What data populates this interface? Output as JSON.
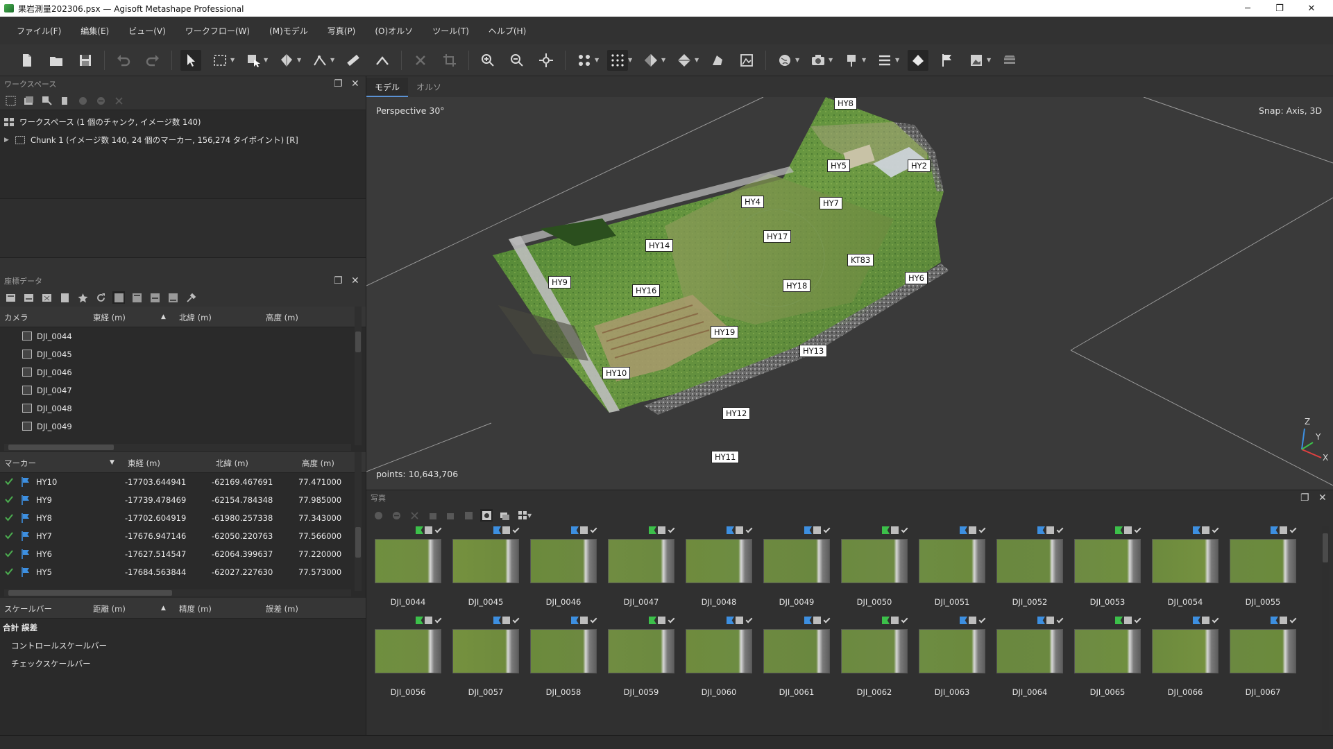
{
  "window": {
    "title": "果岩測量202306.psx — Agisoft Metashape Professional",
    "minimize": "─",
    "maximize": "❐",
    "close": "✕"
  },
  "menu": [
    "ファイル(F)",
    "編集(E)",
    "ビュー(V)",
    "ワークフロー(W)",
    "(M)モデル",
    "写真(P)",
    "(O)オルソ",
    "ツール(T)",
    "ヘルプ(H)"
  ],
  "workspace": {
    "title": "ワークスペース",
    "root": "ワークスペース (1 個のチャンク, イメージ数 140)",
    "chunk": "Chunk 1 (イメージ数 140, 24 個のマーカー, 156,274 タイポイント) [R]"
  },
  "reference": {
    "title": "座標データ",
    "camera_headers": [
      "カメラ",
      "東経 (m)",
      "北緯 (m)",
      "高度 (m)"
    ],
    "cameras": [
      "DJI_0044",
      "DJI_0045",
      "DJI_0046",
      "DJI_0047",
      "DJI_0048",
      "DJI_0049"
    ],
    "marker_headers": [
      "マーカー",
      "東経 (m)",
      "北緯 (m)",
      "高度 (m)"
    ],
    "markers": [
      {
        "name": "HY10",
        "east": "-17703.644941",
        "north": "-62169.467691",
        "alt": "77.471000"
      },
      {
        "name": "HY9",
        "east": "-17739.478469",
        "north": "-62154.784348",
        "alt": "77.985000"
      },
      {
        "name": "HY8",
        "east": "-17702.604919",
        "north": "-61980.257338",
        "alt": "77.343000"
      },
      {
        "name": "HY7",
        "east": "-17676.947146",
        "north": "-62050.220763",
        "alt": "77.566000"
      },
      {
        "name": "HY6",
        "east": "-17627.514547",
        "north": "-62064.399637",
        "alt": "77.220000"
      },
      {
        "name": "HY5",
        "east": "-17684.563844",
        "north": "-62027.227630",
        "alt": "77.573000"
      }
    ],
    "scalebar_headers": [
      "スケールバー",
      "距離 (m)",
      "精度 (m)",
      "誤差 (m)"
    ],
    "scalebar_total": "合計 誤差",
    "scalebar_rows": [
      "コントロールスケールバー",
      "チェックスケールバー"
    ]
  },
  "tabs": [
    "モデル",
    "オルソ"
  ],
  "viewport": {
    "projection": "Perspective 30°",
    "snap": "Snap: Axis, 3D",
    "points": "points: 10,643,706",
    "axis": {
      "x": "X",
      "y": "Y",
      "z": "Z"
    },
    "markers": [
      "HY8",
      "HY5",
      "HY2",
      "HY4",
      "HY7",
      "HY17",
      "HY14",
      "KT83",
      "HY9",
      "HY16",
      "HY18",
      "HY6",
      "HY19",
      "HY13",
      "HY10",
      "HY12",
      "HY11"
    ]
  },
  "photos": {
    "title": "写真",
    "row1": [
      "DJI_0044",
      "DJI_0045",
      "DJI_0046",
      "DJI_0047",
      "DJI_0048",
      "DJI_0049",
      "DJI_0050",
      "DJI_0051",
      "DJI_0052",
      "DJI_0053",
      "DJI_0054",
      "DJI_0055"
    ],
    "row2": [
      "DJI_0056",
      "DJI_0057",
      "DJI_0058",
      "DJI_0059",
      "DJI_0060",
      "DJI_0061",
      "DJI_0062",
      "DJI_0063",
      "DJI_0064",
      "DJI_0065",
      "DJI_0066",
      "DJI_0067"
    ]
  },
  "colors": {
    "accent": "#5b92d4",
    "check": "#4caf50",
    "flag_blue": "#3d8fe0",
    "flag_green": "#3cc04a"
  }
}
